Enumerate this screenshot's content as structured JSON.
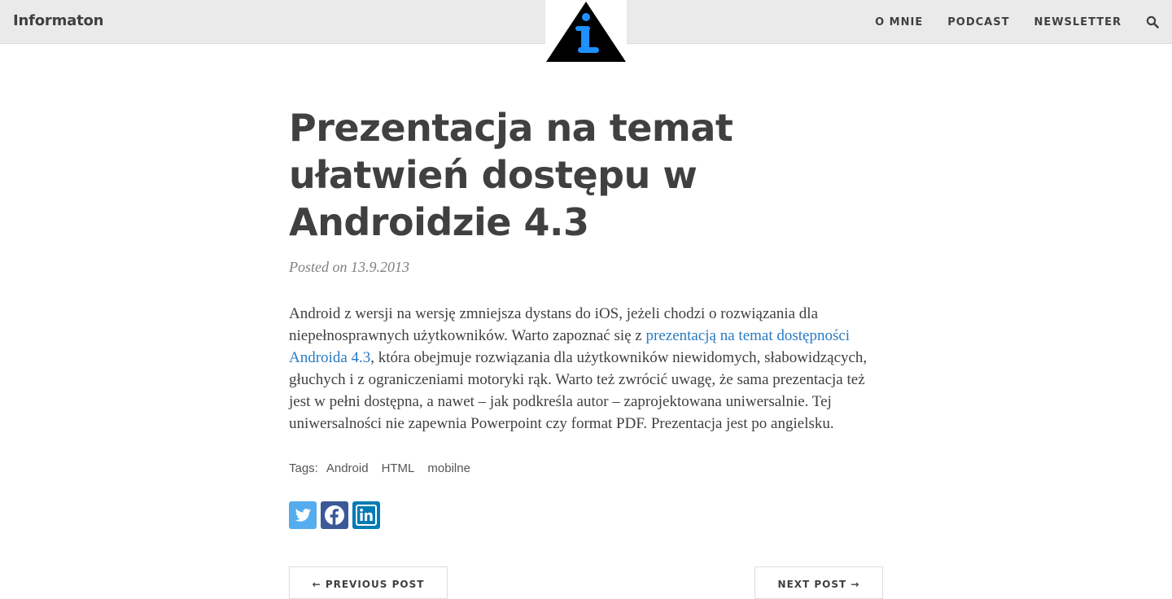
{
  "navbar": {
    "brand": "Informaton",
    "links": [
      "O MNIE",
      "PODCAST",
      "NEWSLETTER"
    ],
    "search_icon": "search-icon",
    "logo_icon": "info-triangle-logo"
  },
  "post": {
    "title": "Prezentacja na temat ułatwień dostępu w Androidzie 4.3",
    "meta": "Posted on 13.9.2013",
    "body_before_link": "Android z wersji na wersję zmniejsza dystans do iOS, jeżeli chodzi o rozwiązania dla niepełnosprawnych użytkowników. Warto zapoznać się z ",
    "link_text": "prezentacją na temat dostępności Androida 4.3",
    "body_after_link": ", która obejmuje rozwiązania dla użytkowników niewidomych, słabowidzących, głuchych i z ograniczeniami motoryki rąk. Warto też zwrócić uwagę, że sama prezentacja też jest w pełni dostępna, a nawet – jak podkreśla autor – zaprojektowana uniwersalnie. Tej uniwersalności nie zapewnia Powerpoint czy format PDF. Prezentacja jest po angielsku.",
    "tags_label": "Tags:",
    "tags": [
      "Android",
      "HTML",
      "mobilne"
    ]
  },
  "share": {
    "icons": [
      "twitter-icon",
      "facebook-icon",
      "linkedin-icon"
    ],
    "colors": {
      "twitter": "#55acee",
      "facebook": "#3b5998",
      "linkedin": "#007bb5"
    }
  },
  "pager": {
    "prev_label": "← PREVIOUS POST",
    "next_label": "NEXT POST →"
  },
  "colors": {
    "navbar_bg": "#eaeaea",
    "text": "#404040",
    "link": "#2a7ac2",
    "logo_blue": "#1e90ff"
  }
}
